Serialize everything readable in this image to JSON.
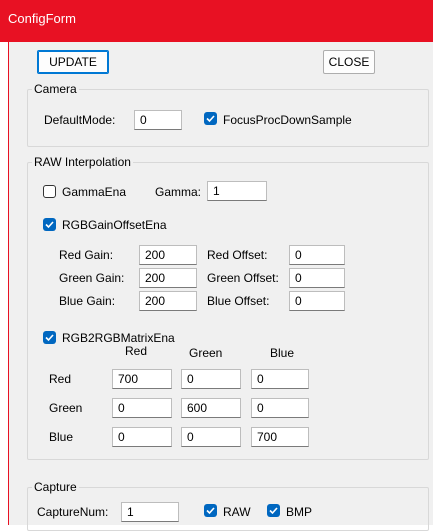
{
  "window": {
    "title": "ConfigForm"
  },
  "toolbar": {
    "update_label": "UPDATE",
    "close_label": "CLOSE"
  },
  "camera": {
    "legend": "Camera",
    "default_mode_label": "DefaultMode:",
    "default_mode_value": "0",
    "focus_label": "FocusProcDownSample",
    "focus_checked": true
  },
  "raw": {
    "legend": "RAW Interpolation",
    "gamma_ena_label": "GammaEna",
    "gamma_ena_checked": false,
    "gamma_label": "Gamma:",
    "gamma_value": "1",
    "rgb_gain_offset_label": "RGBGainOffsetEna",
    "rgb_gain_offset_checked": true,
    "red_gain_label": "Red Gain:",
    "red_gain_value": "200",
    "green_gain_label": "Green Gain:",
    "green_gain_value": "200",
    "blue_gain_label": "Blue Gain:",
    "blue_gain_value": "200",
    "red_offset_label": "Red Offset:",
    "red_offset_value": "0",
    "green_offset_label": "Green Offset:",
    "green_offset_value": "0",
    "blue_offset_label": "Blue Offset:",
    "blue_offset_value": "0",
    "matrix_ena_label": "RGB2RGBMatrixEna",
    "matrix_ena_checked": true,
    "matrix_col_red": "Red",
    "matrix_col_green": "Green",
    "matrix_col_blue": "Blue",
    "matrix_row_red": "Red",
    "matrix_row_green": "Green",
    "matrix_row_blue": "Blue",
    "matrix": [
      [
        "700",
        "0",
        "0"
      ],
      [
        "0",
        "600",
        "0"
      ],
      [
        "0",
        "0",
        "700"
      ]
    ]
  },
  "capture": {
    "legend": "Capture",
    "capture_num_label": "CaptureNum:",
    "capture_num_value": "1",
    "raw_label": "RAW",
    "raw_checked": true,
    "bmp_label": "BMP",
    "bmp_checked": true
  },
  "colors": {
    "title_bar": "#e81123",
    "checkbox_accent": "#0067c0",
    "window_bg": "#f0f0f0"
  }
}
